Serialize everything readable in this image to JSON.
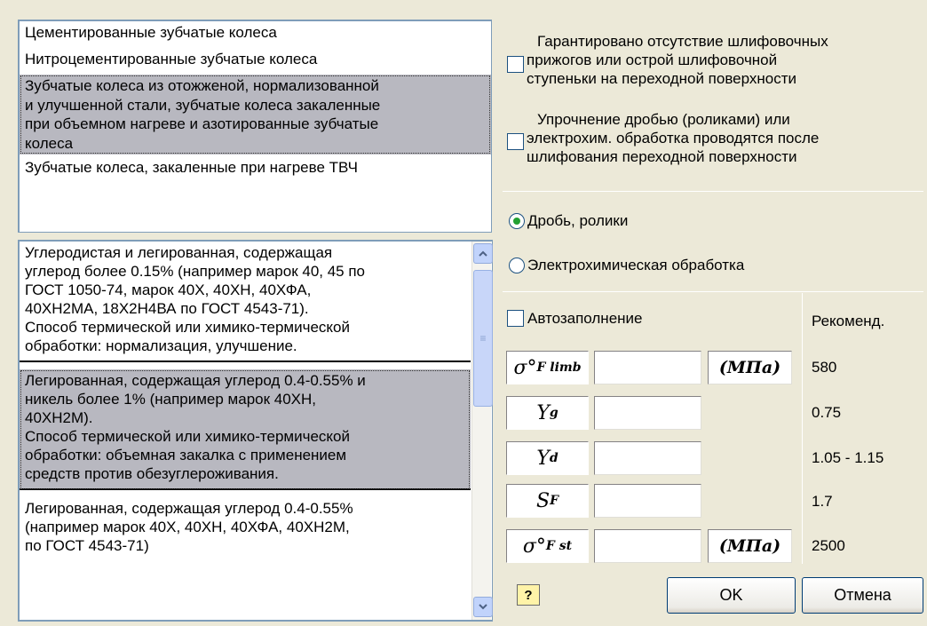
{
  "gear_types": [
    {
      "lines": [
        "Цементированные зубчатые колеса"
      ],
      "selected": false
    },
    {
      "lines": [
        "Нитроцементированные зубчатые колеса"
      ],
      "selected": false
    },
    {
      "lines": [
        "Зубчатые колеса из отожженой, нормализованной",
        "и улучшенной стали, зубчатые колеса закаленные",
        "при объемном нагреве и азотированные зубчатые",
        "колеса"
      ],
      "selected": true
    },
    {
      "lines": [
        "Зубчатые колеса, закаленные при нагреве ТВЧ"
      ],
      "selected": false
    }
  ],
  "steels": [
    {
      "lines": [
        "Углеродистая и легированная, содержащая",
        "углерод более 0.15% (например марок 40, 45 по",
        "ГОСТ 1050-74, марок 40Х, 40ХН, 40ХФА,",
        "40ХН2МА, 18Х2Н4ВА по ГОСТ 4543-71).",
        "Способ термической или химико-термической",
        "обработки: нормализация, улучшение."
      ],
      "selected": false
    },
    {
      "lines": [
        "Легированная, содержащая углерод 0.4-0.55% и",
        "никель более 1% (например марок 40ХН,",
        "40ХН2М).",
        "Способ термической или химико-термической",
        "обработки: объемная закалка с применением",
        "средств против обезуглероживания."
      ],
      "selected": true
    },
    {
      "lines": [
        "Легированная, содержащая углерод 0.4-0.55%",
        "(например марок 40Х, 40ХН, 40ХФА, 40ХН2М,",
        "по ГОСТ 4543-71)"
      ],
      "selected": false
    }
  ],
  "options": {
    "no_burns": {
      "lines": [
        "Гарантировано отсутствие шлифовочных",
        "прижогов или острой шлифовочной",
        "ступеньки на переходной поверхности"
      ],
      "checked": false
    },
    "hardening": {
      "lines": [
        "Упрочнение дробью (роликами) или",
        "электрохим. обработка проводятся после",
        "шлифования переходной поверхности"
      ],
      "checked": false
    }
  },
  "radios": {
    "shot": {
      "label": "Дробь, ролики",
      "selected": true
    },
    "electrochem": {
      "label": "Электрохимическая обработка",
      "selected": false
    }
  },
  "autofill": {
    "label": "Автозаполнение",
    "checked": false
  },
  "recommended_header": "Рекоменд.",
  "params": [
    {
      "symbol": "σ°",
      "sub": "F limb",
      "value": "",
      "unit": "(МПа)",
      "recommended": "580"
    },
    {
      "symbol": "Y",
      "sub": "g",
      "value": "",
      "unit": "",
      "recommended": "0.75"
    },
    {
      "symbol": "Y",
      "sub": "d",
      "value": "",
      "unit": "",
      "recommended": "1.05 - 1.15"
    },
    {
      "symbol": "S",
      "sub": "F",
      "value": "",
      "unit": "",
      "recommended": "1.7"
    },
    {
      "symbol": "σ°",
      "sub": "F st",
      "value": "",
      "unit": "(МПа)",
      "recommended": "2500"
    }
  ],
  "buttons": {
    "help": "?",
    "ok": "OK",
    "cancel": "Отмена"
  },
  "icons": {
    "scroll_up": "chevron-up-icon",
    "scroll_down": "chevron-down-icon",
    "help": "help-icon"
  }
}
